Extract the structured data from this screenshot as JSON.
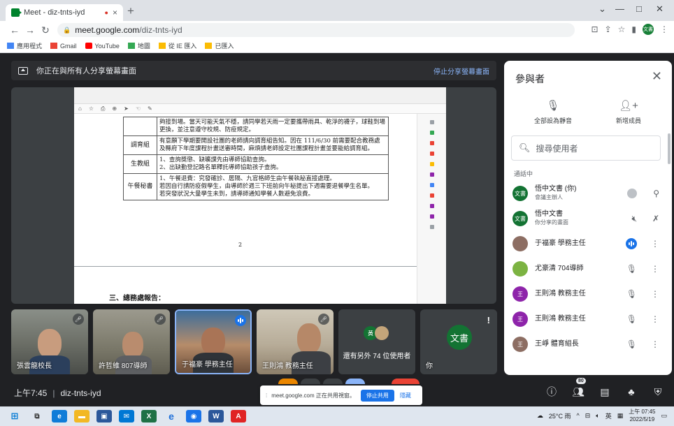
{
  "browser": {
    "tab_title": "Meet - diz-tnts-iyd",
    "tab_close": "×",
    "new_tab": "+",
    "url_host": "meet.google.com",
    "url_path": "/diz-tnts-iyd",
    "win_min": "—",
    "win_max": "□",
    "win_close": "✕",
    "profile_initials": "文書",
    "bookmarks": [
      {
        "label": "應用程式",
        "icon": "apps-icon",
        "color": "#4285f4"
      },
      {
        "label": "Gmail",
        "icon": "gmail-icon",
        "color": "#ea4335"
      },
      {
        "label": "YouTube",
        "icon": "youtube-icon",
        "color": "#ff0000"
      },
      {
        "label": "地圖",
        "icon": "maps-icon",
        "color": "#34a853"
      },
      {
        "label": "從 IE 匯入",
        "icon": "folder-icon",
        "color": "#fbbc04"
      },
      {
        "label": "已匯入",
        "icon": "folder-icon",
        "color": "#fbbc04"
      }
    ]
  },
  "meet": {
    "presenting_text": "你正在與所有人分享螢幕畫面",
    "stop_presenting": "停止分享螢幕畫面",
    "meeting_time": "上午7:45",
    "meeting_code": "diz-tnts-iyd",
    "sharing_toast_text": "meet.google.com 正在共用視窗。",
    "sharing_toast_stop": "停止共用",
    "sharing_toast_hide": "隱藏",
    "participants_badge": "80",
    "others_text": "還有另外 74 位使用者",
    "you_label": "你",
    "you_avatar": "文書",
    "tiles": [
      {
        "name": "張雲龍校長"
      },
      {
        "name": "許哲維 807導師"
      },
      {
        "name": "于福豪 學務主任"
      },
      {
        "name": "王則鴻 教務主任"
      }
    ]
  },
  "shared_doc": {
    "rows": [
      {
        "key": "",
        "text": "夠接到場。當天可能天氣不穩，請同學若天雨一定要攜帶雨具、乾淨的襪子，球鞋到場更換，並注意遵守校規、防疫規定。"
      },
      {
        "key": "調育組",
        "text": "有意願下學期要開設社團的老師請向調育組告知。因在 111/6/30 前需要配合教務處及縣府下年度課程計畫送審時間，麻煩請老師設定社團課程計畫並要能給調育組。"
      },
      {
        "key": "生教組",
        "text": "1、查詢獎懲、缺曠課先由導師協助查詢。\n2、出缺勤登記路名單釋託導師協助孩子查詢。"
      },
      {
        "key": "午餐秘書",
        "text": "1、午餐退費：究發確診、居隔、九官格師生由午餐執秘直接處理。\n若因自行請防疫假學生，由導師於週三下班前向午秘提出下週需要退餐學生名單。\n若突發狀況大量學生未到，請導師通知學餐人數避免浪費。"
      }
    ],
    "page_number": "2",
    "heading": "三、總務處報告："
  },
  "people_panel": {
    "title": "參與者",
    "mute_all": "全部設為靜音",
    "add_people": "新增成員",
    "search_placeholder": "搜尋使用者",
    "section": "通話中",
    "participants": [
      {
        "name": "悟中文書 (你)",
        "sub": "會議主辦人",
        "avatar": "文書",
        "color": "#137333"
      },
      {
        "name": "悟中文書",
        "sub": "你分享的畫面",
        "avatar": "文書",
        "color": "#137333"
      },
      {
        "name": "于福豪 學務主任",
        "sub": "",
        "avatar": "于",
        "color": "#8d6e63"
      },
      {
        "name": "尤豪清 704導師",
        "sub": "",
        "avatar": "尤",
        "color": "#7cb342"
      },
      {
        "name": "王則鴻 教務主任",
        "sub": "",
        "avatar": "王",
        "color": "#8e24aa"
      },
      {
        "name": "王則鴻 教務主任",
        "sub": "",
        "avatar": "王",
        "color": "#8e24aa"
      },
      {
        "name": "王崢 體育組長",
        "sub": "",
        "avatar": "王",
        "color": "#8d6e63"
      }
    ]
  },
  "taskbar": {
    "weather": "25°C 雨",
    "ime": "英",
    "time": "上午 07:45",
    "date": "2022/5/19"
  }
}
